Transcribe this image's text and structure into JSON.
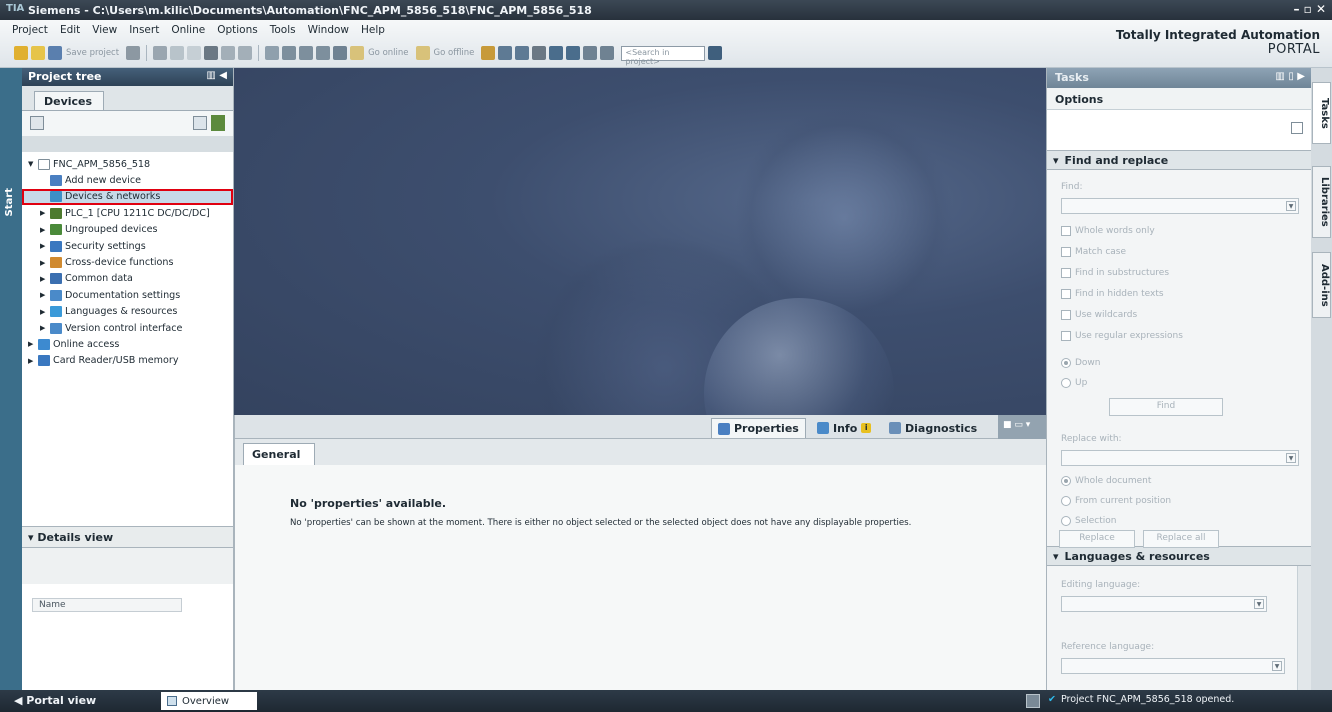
{
  "window": {
    "title": "Siemens - C:\\Users\\m.kilic\\Documents\\Automation\\FNC_APM_5856_518\\FNC_APM_5856_518",
    "controls": "– ▫ ✕"
  },
  "menu": [
    "Project",
    "Edit",
    "View",
    "Insert",
    "Online",
    "Options",
    "Tools",
    "Window",
    "Help"
  ],
  "toolbar": {
    "save_project": "Save project",
    "go_online": "Go online",
    "go_offline": "Go offline",
    "search_placeholder": "<Search in project>"
  },
  "brand": {
    "line1": "Totally Integrated Automation",
    "line2": "PORTAL"
  },
  "start_strip": {
    "label": "Start"
  },
  "project_tree": {
    "title": "Project tree",
    "tab": "Devices",
    "items": [
      {
        "label": "FNC_APM_5856_518",
        "level": 0,
        "expanded": true,
        "icon_color": "#ffffff"
      },
      {
        "label": "Add new device",
        "level": 1,
        "expanded": null,
        "icon_color": "#4a7fc1"
      },
      {
        "label": "Devices & networks",
        "level": 1,
        "expanded": null,
        "icon_color": "#3d8fc7",
        "selected": true
      },
      {
        "label": "PLC_1 [CPU 1211C DC/DC/DC]",
        "level": 1,
        "expanded": false,
        "icon_color": "#4d7a2e"
      },
      {
        "label": "Ungrouped devices",
        "level": 1,
        "expanded": false,
        "icon_color": "#4a8a3a"
      },
      {
        "label": "Security settings",
        "level": 1,
        "expanded": false,
        "icon_color": "#3a78c0"
      },
      {
        "label": "Cross-device functions",
        "level": 1,
        "expanded": false,
        "icon_color": "#d08a30"
      },
      {
        "label": "Common data",
        "level": 1,
        "expanded": false,
        "icon_color": "#3b6fb0"
      },
      {
        "label": "Documentation settings",
        "level": 1,
        "expanded": false,
        "icon_color": "#4a8ac9"
      },
      {
        "label": "Languages & resources",
        "level": 1,
        "expanded": false,
        "icon_color": "#3a9ad9"
      },
      {
        "label": "Version control interface",
        "level": 1,
        "expanded": false,
        "icon_color": "#4a8ac9"
      },
      {
        "label": "Online access",
        "level": 0,
        "expanded": false,
        "icon_color": "#3d8ad0"
      },
      {
        "label": "Card Reader/USB memory",
        "level": 0,
        "expanded": false,
        "icon_color": "#3a78c0"
      }
    ],
    "details_view": "Details view",
    "details_column": "Name"
  },
  "inspector": {
    "tabs": {
      "properties": "Properties",
      "info": "Info",
      "info_badge": "i",
      "diagnostics": "Diagnostics"
    },
    "general_tab": "General",
    "message_title": "No 'properties' available.",
    "message_text": "No 'properties' can be shown at the moment. There is either no object selected or the selected object does not have any displayable properties."
  },
  "tasks": {
    "title": "Tasks",
    "options": "Options",
    "find_replace": {
      "header": "Find and replace",
      "find_label": "Find:",
      "checks": [
        "Whole words only",
        "Match case",
        "Find in substructures",
        "Find in hidden texts",
        "Use wildcards",
        "Use regular expressions"
      ],
      "direction": [
        "Down",
        "Up"
      ],
      "direction_selected": "Down",
      "find_button": "Find",
      "replace_label": "Replace with:",
      "scope": [
        "Whole document",
        "From current position",
        "Selection"
      ],
      "scope_selected": "Whole document",
      "replace_button": "Replace",
      "replace_all_button": "Replace all"
    },
    "languages": {
      "header": "Languages & resources",
      "editing_label": "Editing language:",
      "reference_label": "Reference language:"
    }
  },
  "side_tabs": [
    "Tasks",
    "Libraries",
    "Add-ins"
  ],
  "statusbar": {
    "portal_view": "Portal view",
    "overview": "Overview",
    "message": "Project FNC_APM_5856_518 opened."
  }
}
